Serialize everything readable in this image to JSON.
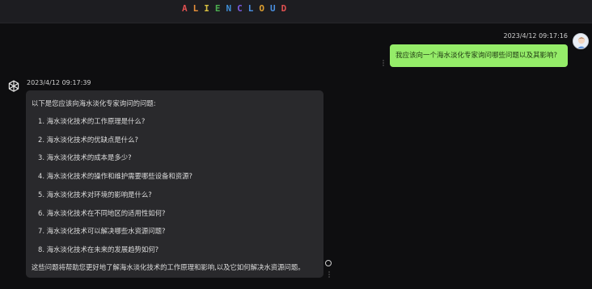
{
  "header": {
    "brand_letters": [
      {
        "ch": "A",
        "color": "#e05050"
      },
      {
        "ch": "L",
        "color": "#e8903a"
      },
      {
        "ch": "I",
        "color": "#d8c040"
      },
      {
        "ch": "E",
        "color": "#4caf50"
      },
      {
        "ch": "N",
        "color": "#3f8fd8"
      },
      {
        "ch": "C",
        "color": "#7b5be0"
      },
      {
        "ch": "L",
        "color": "#4a90e2"
      },
      {
        "ch": "O",
        "color": "#e0a030"
      },
      {
        "ch": "U",
        "color": "#4a90e2"
      },
      {
        "ch": "D",
        "color": "#e05050"
      }
    ]
  },
  "conversation": {
    "user_message": {
      "timestamp": "2023/4/12 09:17:16",
      "text": "我应该向一个海水淡化专家询问哪些问题以及其影响?"
    },
    "bot_message": {
      "timestamp": "2023/4/12 09:17:39",
      "intro": "以下是您应该向海水淡化专家询问的问题:",
      "items": [
        "1. 海水淡化技术的工作原理是什么?",
        "2. 海水淡化技术的优缺点是什么?",
        "3. 海水淡化技术的成本是多少?",
        "4. 海水淡化技术的操作和维护需要哪些设备和资源?",
        "5. 海水淡化技术对环境的影响是什么?",
        "6. 海水淡化技术在不同地区的适用性如何?",
        "7. 海水淡化技术可以解决哪些水资源问题?",
        "8. 海水淡化技术在未来的发展趋势如何?"
      ],
      "outro": "这些问题将帮助您更好地了解海水淡化技术的工作原理和影响,以及它如何解决水资源问题。"
    }
  },
  "colors": {
    "user_bubble": "#95ec69",
    "bot_bubble": "#29292c",
    "background": "#0e0e10"
  }
}
